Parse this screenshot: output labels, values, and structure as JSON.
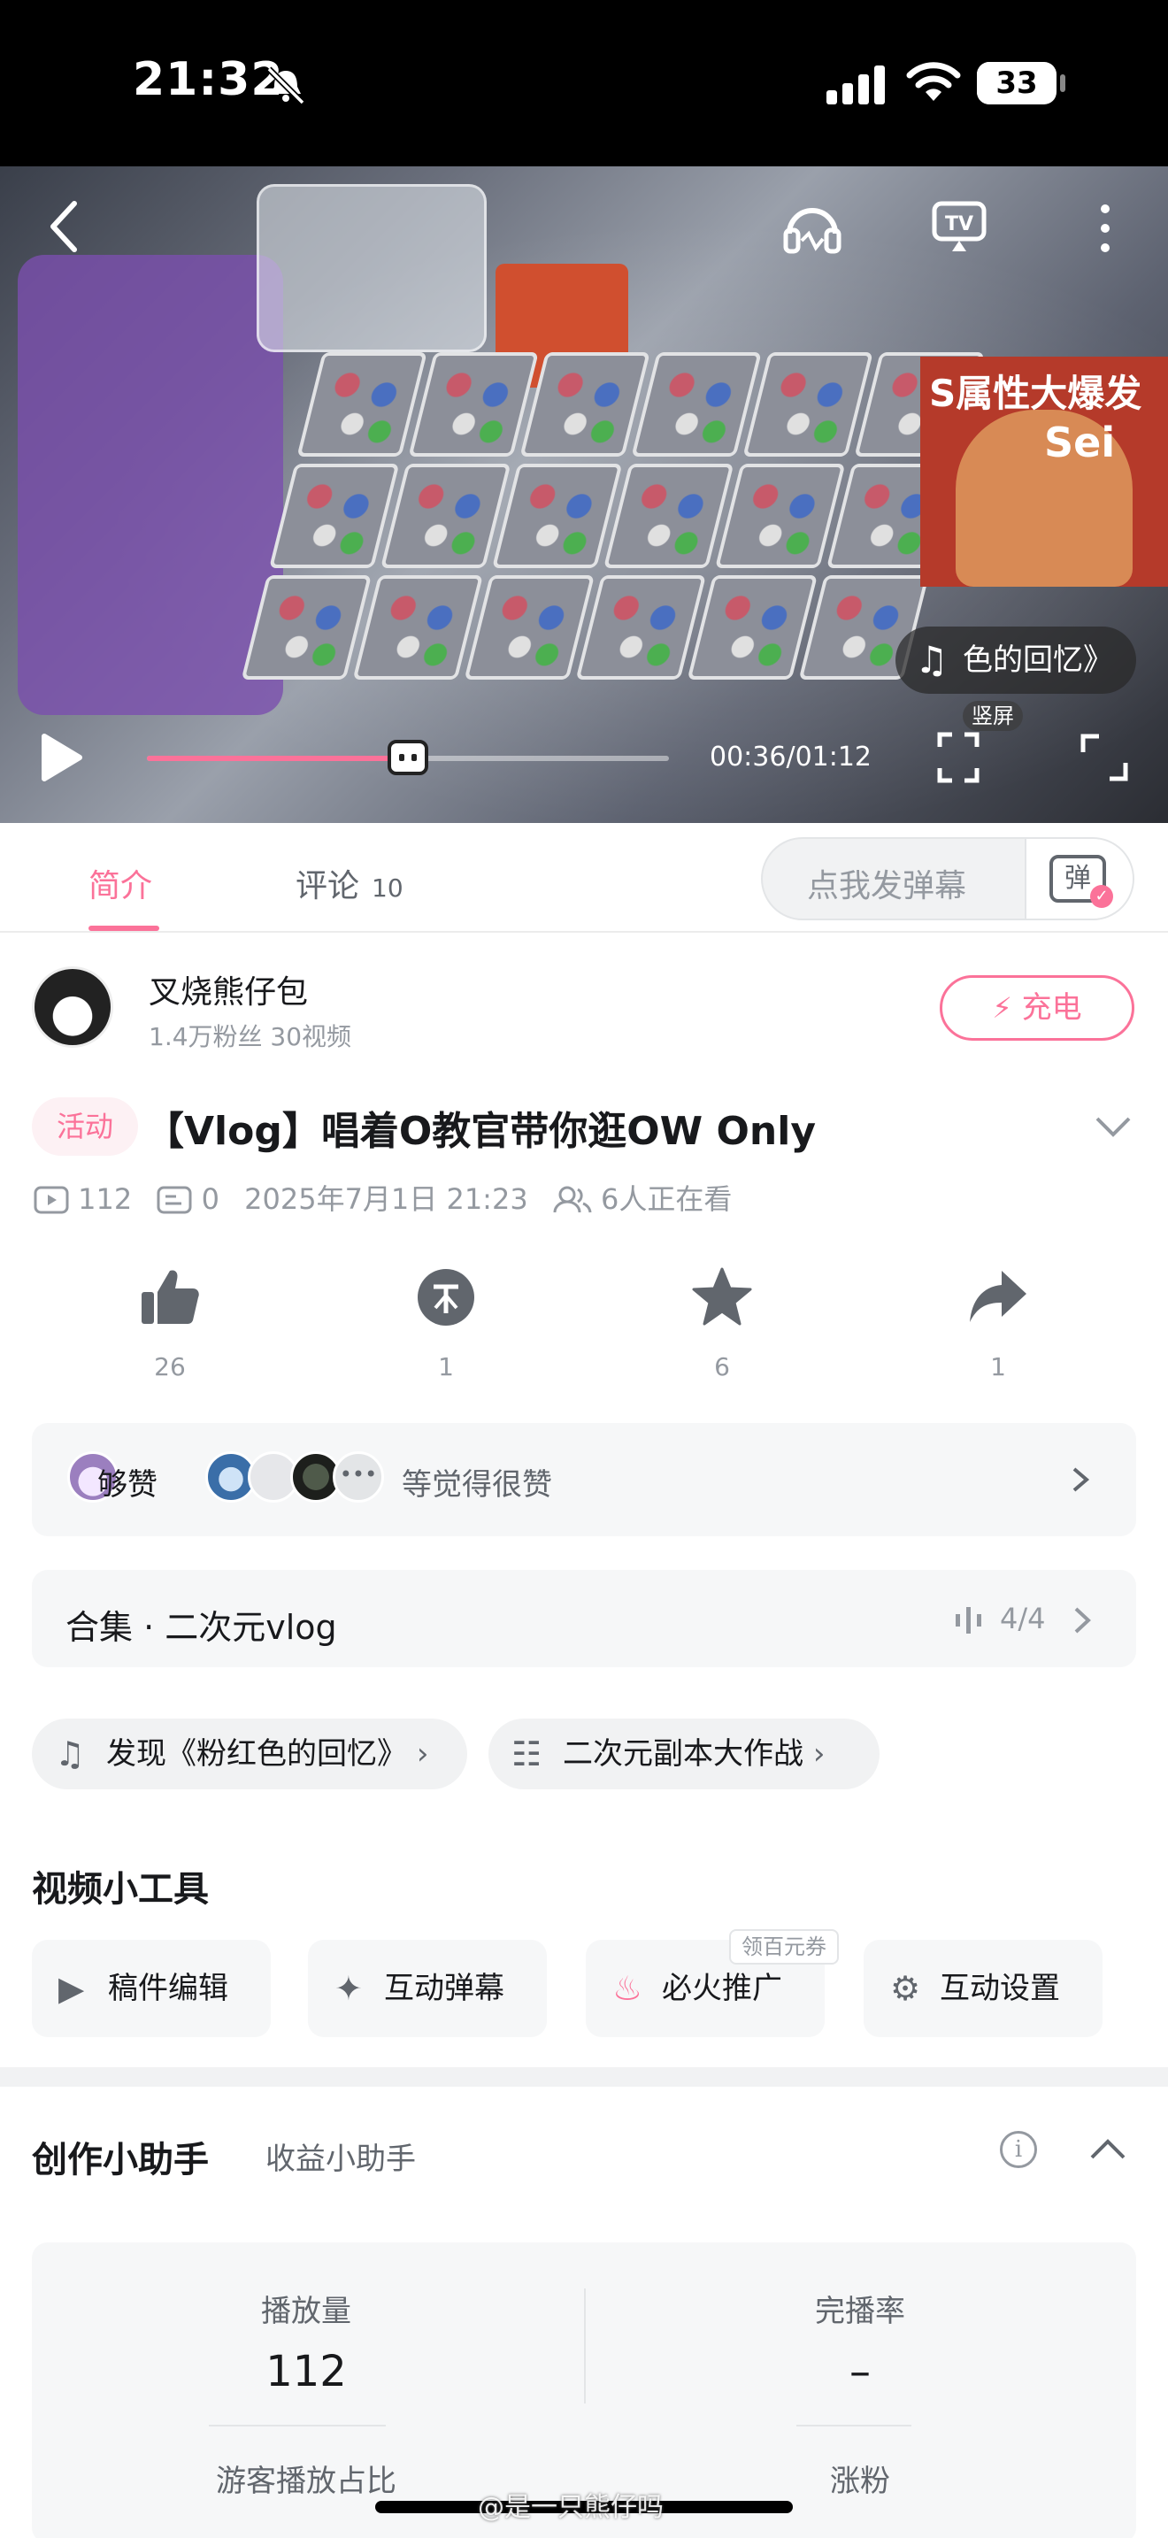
{
  "status_bar": {
    "time": "21:32",
    "battery": "33"
  },
  "video": {
    "current_time": "00:36",
    "total_time": "01:12",
    "time_display": "00:36/01:12",
    "progress": 0.5,
    "music_pill_text": "发现《粉红色的回忆》",
    "music_pill_visible_text": "色的回忆》",
    "vertical_label": "竖屏",
    "poster_title": "S属性大爆发",
    "poster_word": "Sei",
    "accent": "#fb7299"
  },
  "tabs": {
    "intro": "简介",
    "comments": "评论",
    "comments_count": "10",
    "danmaku_placeholder": "点我发弹幕",
    "danmaku_button": "弹"
  },
  "uploader": {
    "name": "叉烧熊仔包",
    "stats": "1.4万粉丝  30视频",
    "charge_label": "充电"
  },
  "title": {
    "badge": "活动",
    "text": "【Vlog】唱着O教官带你逛OW Only"
  },
  "meta": {
    "views": "112",
    "danmaku": "0",
    "date": "2025年7月1日 21:23",
    "watching": "6人正在看"
  },
  "actions": [
    {
      "name": "like",
      "icon": "thumb-up-icon",
      "count": "26"
    },
    {
      "name": "coin",
      "icon": "coin-icon",
      "count": "1"
    },
    {
      "name": "favorite",
      "icon": "star-icon",
      "count": "6"
    },
    {
      "name": "share",
      "icon": "share-icon",
      "count": "1"
    }
  ],
  "liked_by": {
    "label": "够赞",
    "tail": "等觉得很赞"
  },
  "collection": {
    "title": "合集 · 二次元vlog",
    "count": "4/4"
  },
  "chips": [
    {
      "icon": "music-note-icon",
      "label": "发现《粉红色的回忆》"
    },
    {
      "icon": "hashtag-icon",
      "label": "二次元副本大作战"
    }
  ],
  "tools": {
    "title": "视频小工具",
    "items": [
      {
        "icon": "edit-video-icon",
        "label": "稿件编辑"
      },
      {
        "icon": "danmaku-icon",
        "label": "互动弹幕"
      },
      {
        "icon": "fire-icon",
        "label": "必火推广"
      },
      {
        "icon": "settings-lock-icon",
        "label": "互动设置"
      }
    ],
    "tag": "领百元券"
  },
  "helper": {
    "title": "创作小助手",
    "subtitle": "收益小助手",
    "stats": [
      {
        "label": "播放量",
        "value": "112"
      },
      {
        "label": "完播率",
        "value": "–"
      },
      {
        "label": "游客播放占比",
        "value": ""
      },
      {
        "label": "涨粉",
        "value": ""
      }
    ]
  },
  "watermark": "@是一只熊仔吗"
}
